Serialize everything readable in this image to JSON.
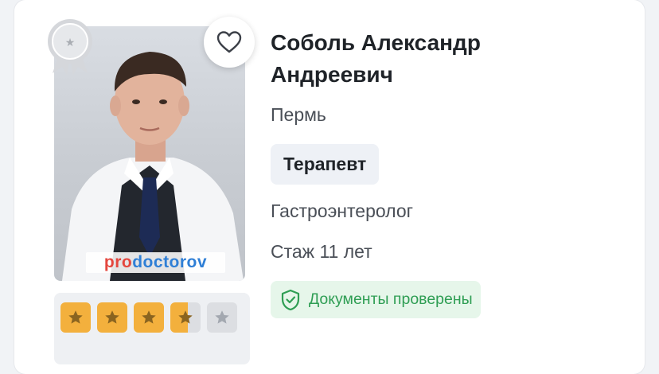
{
  "doctor": {
    "name": "Соболь Александр Андреевич",
    "city": "Пермь",
    "specialty": "Терапевт",
    "subspecialty": "Гастроэнтеролог",
    "experience": "Стаж 11 лет",
    "documents_label": "Документы проверены"
  },
  "photo": {
    "watermark_part1": "pro",
    "watermark_part2": "doctorov"
  },
  "rating": {
    "value": 3.5,
    "max": 5
  },
  "colors": {
    "star_filled": "#f3b03d",
    "star_empty": "#dcdee2",
    "verified_text": "#2f9e54",
    "verified_bg": "#e6f6ea",
    "specialty_bg": "#eef1f6"
  },
  "icons": {
    "favorite": "heart-outline-icon",
    "badge": "award-medal-icon",
    "verified": "shield-check-icon",
    "star": "star-icon"
  }
}
